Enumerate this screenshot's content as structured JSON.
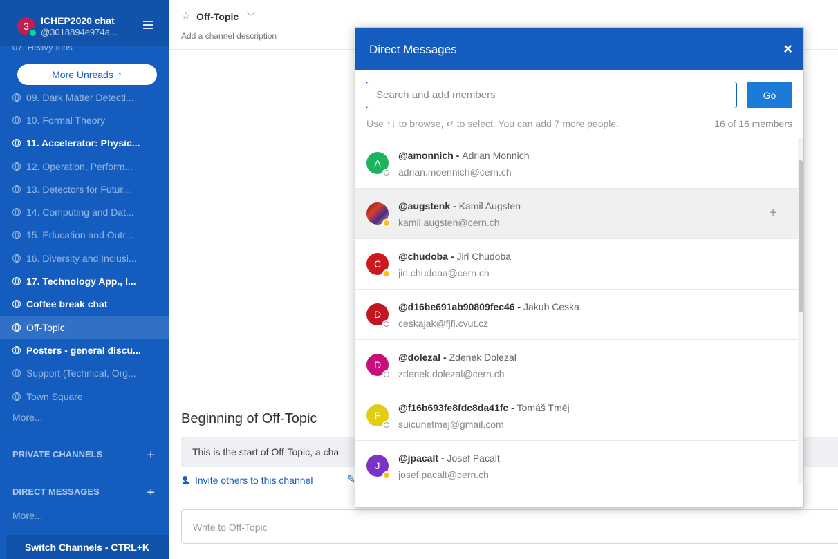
{
  "team": {
    "unread_badge": "3",
    "name": "ICHEP2020 chat",
    "user": "@3018894e974a..."
  },
  "sidebar": {
    "cut_channel": "07. Heavy Ions",
    "more_unreads": "More Unreads",
    "more_unreads_arrow": "↑",
    "channels": [
      {
        "label": "09. Dark Matter Detecti..."
      },
      {
        "label": "10. Formal Theory"
      },
      {
        "label": "11. Accelerator: Physic..."
      },
      {
        "label": "12. Operation, Perform..."
      },
      {
        "label": "13. Detectors for Futur..."
      },
      {
        "label": "14. Computing and Dat..."
      },
      {
        "label": "15. Education and Outr..."
      },
      {
        "label": "16. Diversity and Inclusi..."
      },
      {
        "label": "17. Technology App., I..."
      },
      {
        "label": "Coffee break chat"
      },
      {
        "label": "Off-Topic"
      },
      {
        "label": "Posters - general discu..."
      },
      {
        "label": "Support (Technical, Org..."
      },
      {
        "label": "Town Square"
      }
    ],
    "more_public": "More...",
    "private_channels": "PRIVATE CHANNELS",
    "direct_messages": "DIRECT MESSAGES",
    "more_dm": "More...",
    "switch_channels": "Switch Channels - CTRL+K"
  },
  "channel": {
    "title": "Off-Topic",
    "description": "Add a channel description",
    "beginning": "Beginning of Off-Topic",
    "intro": "This is the start of Off-Topic, a cha",
    "invite": "Invite others to this channel",
    "placeholder": "Write to Off-Topic"
  },
  "modal": {
    "title": "Direct Messages",
    "close": "×",
    "search_placeholder": "Search and add members",
    "go": "Go",
    "help": "Use ↑↓ to browse, ↵ to select. You can add 7 more people.",
    "count": "16 of 16 members",
    "members": [
      {
        "username": "@amonnich",
        "sep": " - ",
        "fullname": "Adrian Monnich",
        "email": "adrian.moennich@cern.ch",
        "initial": "A",
        "color": "#1bb35e",
        "status": "offline"
      },
      {
        "username": "@augstenk",
        "sep": " - ",
        "fullname": "Kamil Augsten",
        "email": "kamil.augsten@cern.ch",
        "initial": "",
        "color": "#b03a2a",
        "status": "away"
      },
      {
        "username": "@chudoba",
        "sep": " - ",
        "fullname": "Jiri Chudoba",
        "email": "jiri.chudoba@cern.ch",
        "initial": "C",
        "color": "#cb1a1f",
        "status": "away"
      },
      {
        "username": "@d16be691ab90809fec46",
        "sep": " - ",
        "fullname": "Jakub Ceska",
        "email": "ceskajak@fjfi.cvut.cz",
        "initial": "D",
        "color": "#c21623",
        "status": "offline"
      },
      {
        "username": "@dolezal",
        "sep": " - ",
        "fullname": "Zdenek Dolezal",
        "email": "zdenek.dolezal@cern.ch",
        "initial": "D",
        "color": "#c90f7b",
        "status": "offline"
      },
      {
        "username": "@f16b693fe8fdc8da41fc",
        "sep": " - ",
        "fullname": "Tomáš Tměj",
        "email": "suicunetmej@gmail.com",
        "initial": "F",
        "color": "#e2cd12",
        "status": "offline"
      },
      {
        "username": "@jpacalt",
        "sep": " - ",
        "fullname": "Josef Pacalt",
        "email": "josef.pacalt@cern.ch",
        "initial": "J",
        "color": "#7a33c4",
        "status": "away"
      }
    ]
  }
}
